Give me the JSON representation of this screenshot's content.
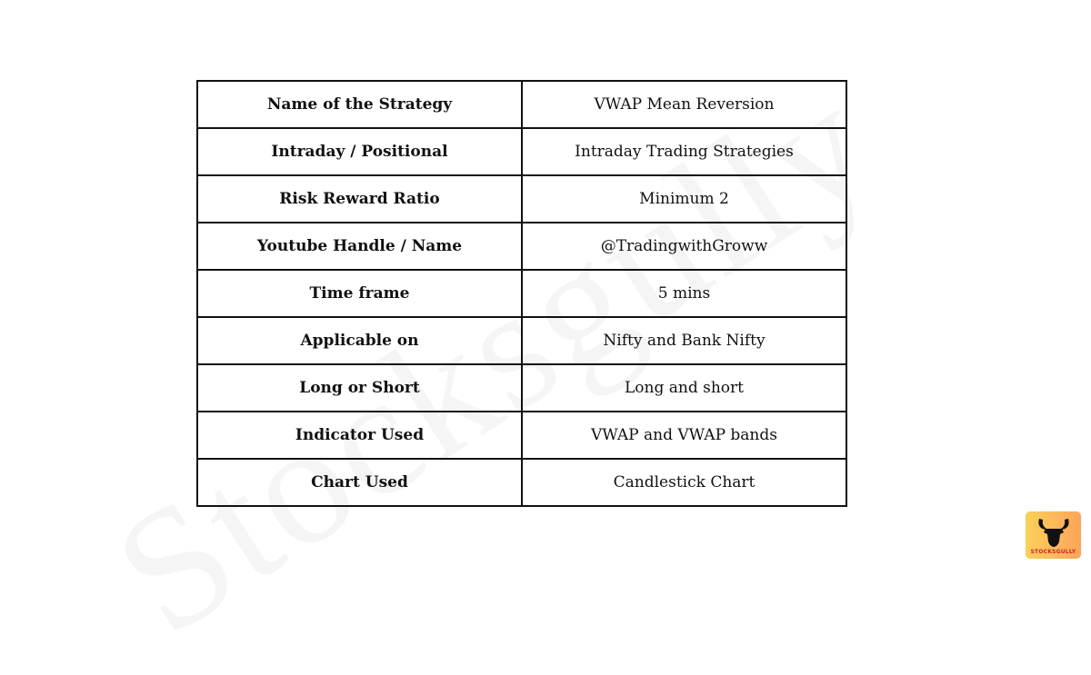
{
  "watermark": "Stocksgully",
  "table": {
    "rows": [
      {
        "label": "Name of the Strategy",
        "value": "VWAP Mean Reversion"
      },
      {
        "label": "Intraday / Positional",
        "value": "Intraday Trading Strategies"
      },
      {
        "label": "Risk Reward Ratio",
        "value": "Minimum 2"
      },
      {
        "label": "Youtube Handle / Name",
        "value": "@TradingwithGroww"
      },
      {
        "label": "Time frame",
        "value": "5 mins"
      },
      {
        "label": "Applicable on",
        "value": "Nifty and Bank Nifty"
      },
      {
        "label": "Long or Short",
        "value": "Long and short"
      },
      {
        "label": "Indicator Used",
        "value": "VWAP and VWAP bands"
      },
      {
        "label": "Chart Used",
        "value": "Candlestick Chart"
      }
    ]
  },
  "logo": {
    "text": "STOCKSGULLY",
    "icon": "bull-head-icon",
    "gradient": [
      "#fbd15a",
      "#fca45a"
    ],
    "text_color": "#c62828"
  }
}
